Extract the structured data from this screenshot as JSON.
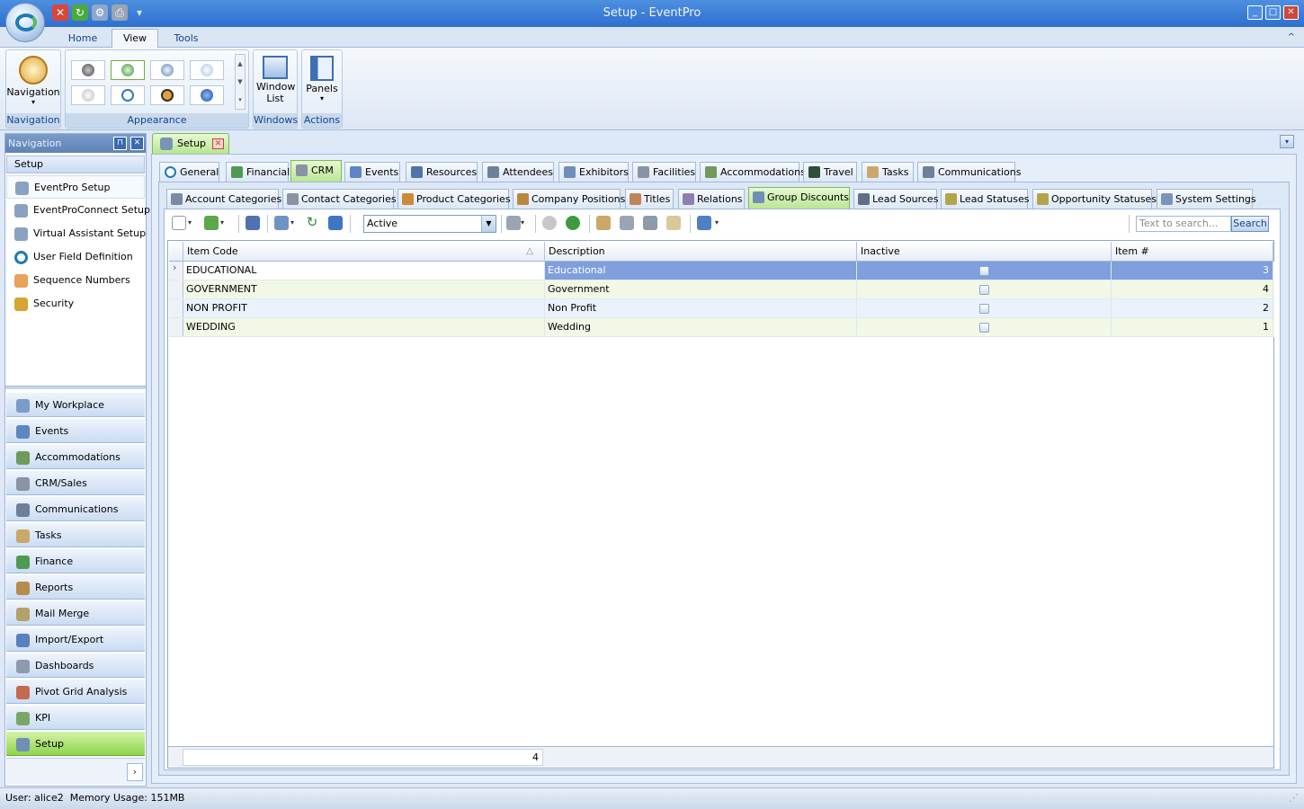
{
  "window": {
    "title": "Setup - EventPro"
  },
  "ribbon": {
    "tabs": [
      "Home",
      "View",
      "Tools"
    ],
    "active_tab": "View",
    "groups": {
      "navigation": {
        "button": "Navigation",
        "label": "Navigation"
      },
      "appearance": {
        "label": "Appearance"
      },
      "windows": {
        "button": "Window List",
        "label": "Windows"
      },
      "actions": {
        "button": "Panels",
        "label": "Actions"
      }
    }
  },
  "nav": {
    "header": "Navigation",
    "section": "Setup",
    "links": [
      "EventPro Setup",
      "EventProConnect Setup",
      "Virtual Assistant Setup",
      "User Field Definition",
      "Sequence Numbers",
      "Security"
    ],
    "buttons": [
      "My Workplace",
      "Events",
      "Accommodations",
      "CRM/Sales",
      "Communications",
      "Tasks",
      "Finance",
      "Reports",
      "Mail Merge",
      "Import/Export",
      "Dashboards",
      "Pivot Grid Analysis",
      "KPI",
      "Setup"
    ]
  },
  "doc_tab": "Setup",
  "tabs_main": [
    "General",
    "Financial",
    "CRM",
    "Events",
    "Resources",
    "Attendees",
    "Exhibitors",
    "Facilities",
    "Accommodations",
    "Travel",
    "Tasks",
    "Communications"
  ],
  "tabs_main_active": "CRM",
  "tabs_sub": [
    "Account Categories",
    "Contact Categories",
    "Product Categories",
    "Company Positions",
    "Titles",
    "Relations",
    "Group Discounts",
    "Lead Sources",
    "Lead Statuses",
    "Opportunity Statuses",
    "System Settings"
  ],
  "tabs_sub_active": "Group Discounts",
  "toolbar": {
    "status_value": "Active",
    "search_placeholder": "Text to search...",
    "search_label": "Search"
  },
  "grid": {
    "columns": [
      "Item Code",
      "Description",
      "Inactive",
      "Item #"
    ],
    "rows": [
      {
        "code": "EDUCATIONAL",
        "description": "Educational",
        "inactive": false,
        "item": "3"
      },
      {
        "code": "GOVERNMENT",
        "description": "Government",
        "inactive": false,
        "item": "4"
      },
      {
        "code": "NON PROFIT",
        "description": "Non Profit",
        "inactive": false,
        "item": "2"
      },
      {
        "code": "WEDDING",
        "description": "Wedding",
        "inactive": false,
        "item": "1"
      }
    ],
    "footer_count": "4"
  },
  "statusbar": {
    "text": "User: alice2  Memory Usage: 151MB"
  }
}
